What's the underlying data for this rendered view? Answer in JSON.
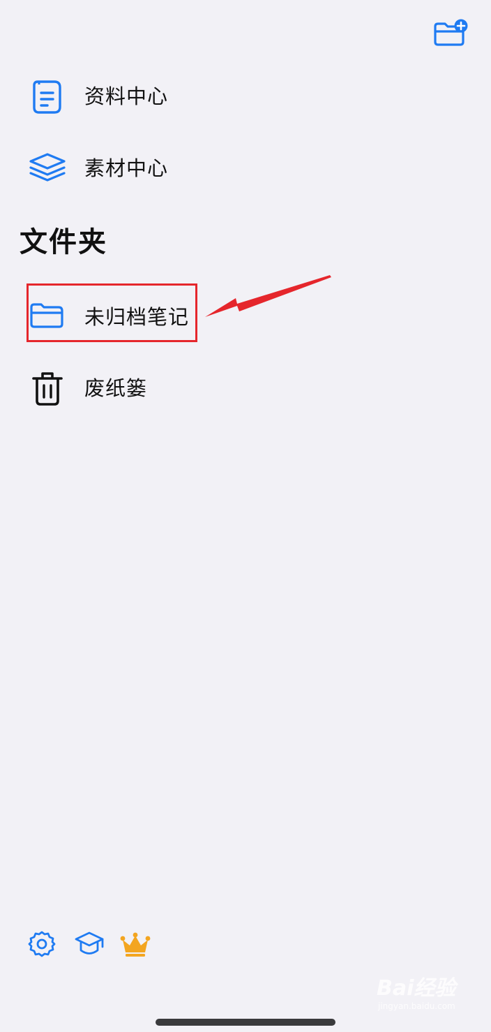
{
  "colors": {
    "background": "#f2f1f6",
    "accent": "#1f7bf2",
    "text": "#111111",
    "premium": "#f3a520",
    "annotation_red": "#e5262c",
    "home_indicator": "#3a3a3c",
    "watermark": "#ffffff"
  },
  "header": {
    "new_folder_icon": "folder-plus-icon"
  },
  "nav": {
    "items": [
      {
        "label": "资料中心",
        "icon": "document-icon"
      },
      {
        "label": "素材中心",
        "icon": "layers-icon"
      }
    ]
  },
  "folders": {
    "title": "文件夹",
    "items": [
      {
        "label": "未归档笔记",
        "icon": "folder-icon",
        "highlighted": true
      },
      {
        "label": "废纸篓",
        "icon": "trash-icon"
      }
    ]
  },
  "footer": {
    "icons": [
      "settings-icon",
      "graduation-cap-icon",
      "crown-icon"
    ]
  },
  "annotation": {
    "type": "arrow",
    "target": "未归档笔记"
  },
  "watermark": {
    "brand": "Bai经验",
    "url": "jingyan.baidu.com"
  }
}
